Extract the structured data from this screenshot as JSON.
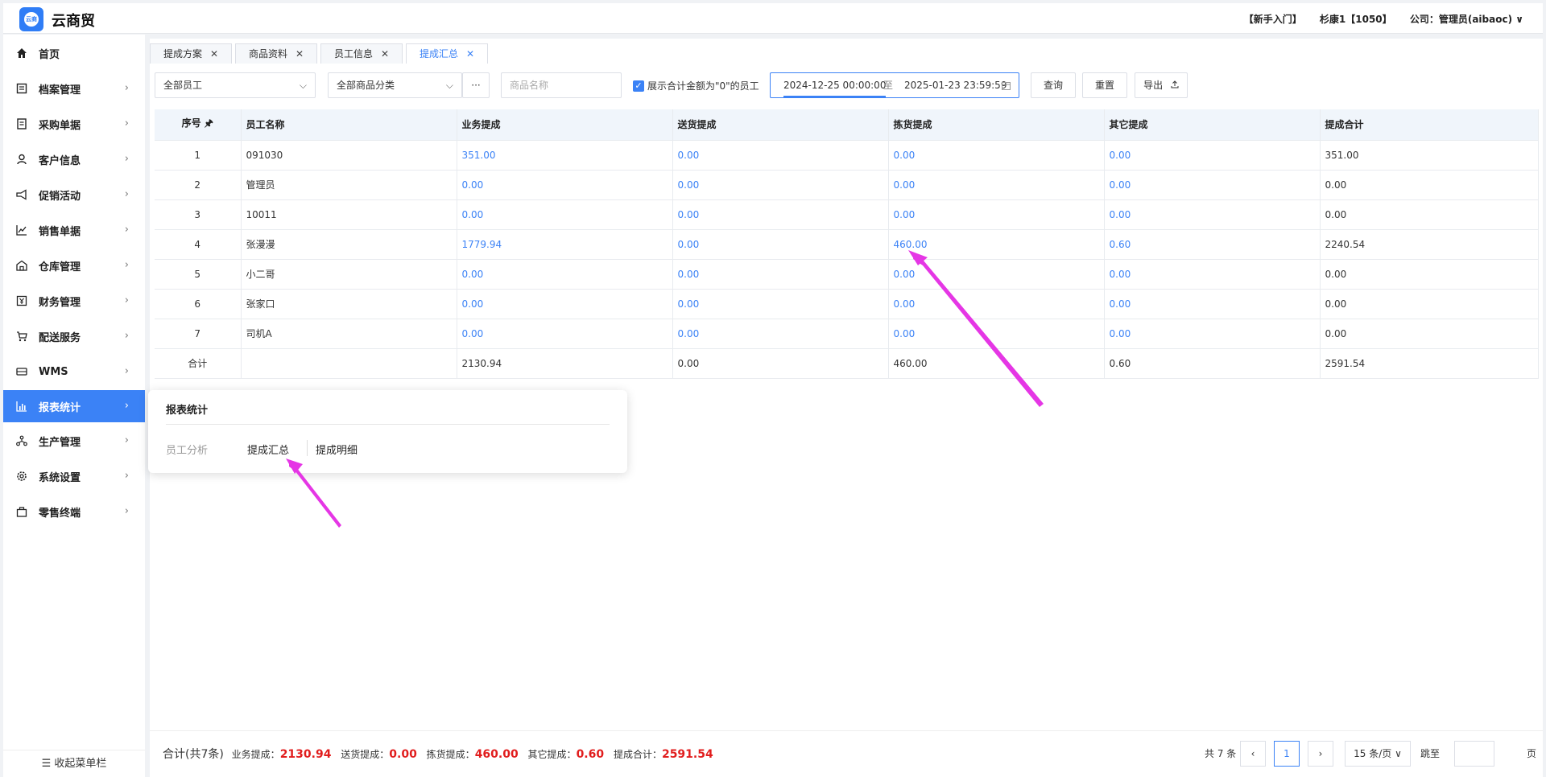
{
  "app": {
    "logo_text": "云商",
    "brand": "云商贸",
    "top_links": [
      "【新手入门】",
      "杉康1【1050】",
      "公司：管理员(aibaoc) ∨"
    ]
  },
  "sidebar": {
    "items": [
      {
        "label": "首页",
        "icon": "home-icon",
        "has_chevron": false
      },
      {
        "label": "档案管理",
        "icon": "archive-icon",
        "has_chevron": true
      },
      {
        "label": "采购单据",
        "icon": "document-icon",
        "has_chevron": true
      },
      {
        "label": "客户信息",
        "icon": "user-icon",
        "has_chevron": true
      },
      {
        "label": "促销活动",
        "icon": "megaphone-icon",
        "has_chevron": true
      },
      {
        "label": "销售单据",
        "icon": "chart-line-icon",
        "has_chevron": true
      },
      {
        "label": "仓库管理",
        "icon": "warehouse-icon",
        "has_chevron": true
      },
      {
        "label": "财务管理",
        "icon": "finance-icon",
        "has_chevron": true
      },
      {
        "label": "配送服务",
        "icon": "cart-icon",
        "has_chevron": true
      },
      {
        "label": "WMS",
        "icon": "truck-icon",
        "has_chevron": true
      },
      {
        "label": "报表统计",
        "icon": "bar-chart-icon",
        "has_chevron": true,
        "active": true
      },
      {
        "label": "生产管理",
        "icon": "network-icon",
        "has_chevron": true
      },
      {
        "label": "系统设置",
        "icon": "gear-icon",
        "has_chevron": true
      },
      {
        "label": "零售终端",
        "icon": "bag-icon",
        "has_chevron": true
      }
    ],
    "collapse_label": "☰ 收起菜单栏",
    "accent": "#3b82f6"
  },
  "tabs": [
    {
      "label": "提成方案",
      "active": false
    },
    {
      "label": "商品资料",
      "active": false
    },
    {
      "label": "员工信息",
      "active": false
    },
    {
      "label": "提成汇总",
      "active": true
    }
  ],
  "toolbar": {
    "employee_select": "全部员工",
    "category_select": "全部商品分类",
    "more_label": "···",
    "product_placeholder": "商品名称",
    "show_zero_label": "展示合计金额为\"0\"的员工",
    "show_zero_checked": true,
    "date_start": "2024-12-25 00:00:00",
    "date_sep": "至",
    "date_end": "2025-01-23 23:59:59",
    "query_label": "查询",
    "reset_label": "重置",
    "export_label": "导出"
  },
  "table": {
    "headers": [
      "序号",
      "员工名称",
      "业务提成",
      "送货提成",
      "拣货提成",
      "其它提成",
      "提成合计"
    ],
    "rows": [
      [
        "1",
        "091030",
        "351.00",
        "0.00",
        "0.00",
        "0.00",
        "351.00"
      ],
      [
        "2",
        "管理员",
        "0.00",
        "0.00",
        "0.00",
        "0.00",
        "0.00"
      ],
      [
        "3",
        "10011",
        "0.00",
        "0.00",
        "0.00",
        "0.00",
        "0.00"
      ],
      [
        "4",
        "张漫漫",
        "1779.94",
        "0.00",
        "460.00",
        "0.60",
        "2240.54"
      ],
      [
        "5",
        "小二哥",
        "0.00",
        "0.00",
        "0.00",
        "0.00",
        "0.00"
      ],
      [
        "6",
        "张家口",
        "0.00",
        "0.00",
        "0.00",
        "0.00",
        "0.00"
      ],
      [
        "7",
        "司机A",
        "0.00",
        "0.00",
        "0.00",
        "0.00",
        "0.00"
      ]
    ],
    "total_row": [
      "合计",
      "",
      "2130.94",
      "0.00",
      "460.00",
      "0.60",
      "2591.54"
    ],
    "link_color": "#3b82f6"
  },
  "popup": {
    "title": "报表统计",
    "items": [
      "员工分析",
      "提成汇总",
      "提成明细"
    ]
  },
  "footer": {
    "summary_prefix": "合计(共7条)",
    "business_label": "业务提成：",
    "business_value": "2130.94",
    "delivery_label": "送货提成：",
    "delivery_value": "0.00",
    "picking_label": "拣货提成：",
    "picking_value": "460.00",
    "other_label": "其它提成：",
    "other_value": "0.60",
    "total_label": "提成合计：",
    "total_value": "2591.54",
    "total_count": "共 7 条",
    "current_page": "1",
    "page_size": "15 条/页 ∨",
    "goto_label": "跳至",
    "page_unit": "页",
    "highlight_color": "#e11d1d"
  }
}
